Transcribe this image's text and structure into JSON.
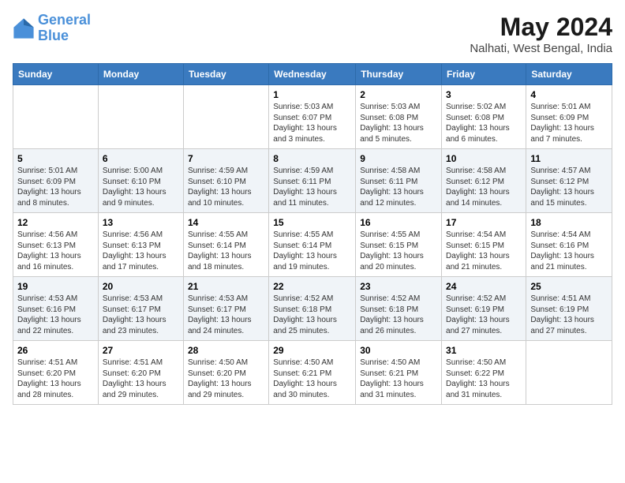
{
  "header": {
    "logo_line1": "General",
    "logo_line2": "Blue",
    "title": "May 2024",
    "subtitle": "Nalhati, West Bengal, India"
  },
  "calendar": {
    "days_of_week": [
      "Sunday",
      "Monday",
      "Tuesday",
      "Wednesday",
      "Thursday",
      "Friday",
      "Saturday"
    ],
    "weeks": [
      [
        {
          "day": "",
          "info": ""
        },
        {
          "day": "",
          "info": ""
        },
        {
          "day": "",
          "info": ""
        },
        {
          "day": "1",
          "info": "Sunrise: 5:03 AM\nSunset: 6:07 PM\nDaylight: 13 hours and 3 minutes."
        },
        {
          "day": "2",
          "info": "Sunrise: 5:03 AM\nSunset: 6:08 PM\nDaylight: 13 hours and 5 minutes."
        },
        {
          "day": "3",
          "info": "Sunrise: 5:02 AM\nSunset: 6:08 PM\nDaylight: 13 hours and 6 minutes."
        },
        {
          "day": "4",
          "info": "Sunrise: 5:01 AM\nSunset: 6:09 PM\nDaylight: 13 hours and 7 minutes."
        }
      ],
      [
        {
          "day": "5",
          "info": "Sunrise: 5:01 AM\nSunset: 6:09 PM\nDaylight: 13 hours and 8 minutes."
        },
        {
          "day": "6",
          "info": "Sunrise: 5:00 AM\nSunset: 6:10 PM\nDaylight: 13 hours and 9 minutes."
        },
        {
          "day": "7",
          "info": "Sunrise: 4:59 AM\nSunset: 6:10 PM\nDaylight: 13 hours and 10 minutes."
        },
        {
          "day": "8",
          "info": "Sunrise: 4:59 AM\nSunset: 6:11 PM\nDaylight: 13 hours and 11 minutes."
        },
        {
          "day": "9",
          "info": "Sunrise: 4:58 AM\nSunset: 6:11 PM\nDaylight: 13 hours and 12 minutes."
        },
        {
          "day": "10",
          "info": "Sunrise: 4:58 AM\nSunset: 6:12 PM\nDaylight: 13 hours and 14 minutes."
        },
        {
          "day": "11",
          "info": "Sunrise: 4:57 AM\nSunset: 6:12 PM\nDaylight: 13 hours and 15 minutes."
        }
      ],
      [
        {
          "day": "12",
          "info": "Sunrise: 4:56 AM\nSunset: 6:13 PM\nDaylight: 13 hours and 16 minutes."
        },
        {
          "day": "13",
          "info": "Sunrise: 4:56 AM\nSunset: 6:13 PM\nDaylight: 13 hours and 17 minutes."
        },
        {
          "day": "14",
          "info": "Sunrise: 4:55 AM\nSunset: 6:14 PM\nDaylight: 13 hours and 18 minutes."
        },
        {
          "day": "15",
          "info": "Sunrise: 4:55 AM\nSunset: 6:14 PM\nDaylight: 13 hours and 19 minutes."
        },
        {
          "day": "16",
          "info": "Sunrise: 4:55 AM\nSunset: 6:15 PM\nDaylight: 13 hours and 20 minutes."
        },
        {
          "day": "17",
          "info": "Sunrise: 4:54 AM\nSunset: 6:15 PM\nDaylight: 13 hours and 21 minutes."
        },
        {
          "day": "18",
          "info": "Sunrise: 4:54 AM\nSunset: 6:16 PM\nDaylight: 13 hours and 21 minutes."
        }
      ],
      [
        {
          "day": "19",
          "info": "Sunrise: 4:53 AM\nSunset: 6:16 PM\nDaylight: 13 hours and 22 minutes."
        },
        {
          "day": "20",
          "info": "Sunrise: 4:53 AM\nSunset: 6:17 PM\nDaylight: 13 hours and 23 minutes."
        },
        {
          "day": "21",
          "info": "Sunrise: 4:53 AM\nSunset: 6:17 PM\nDaylight: 13 hours and 24 minutes."
        },
        {
          "day": "22",
          "info": "Sunrise: 4:52 AM\nSunset: 6:18 PM\nDaylight: 13 hours and 25 minutes."
        },
        {
          "day": "23",
          "info": "Sunrise: 4:52 AM\nSunset: 6:18 PM\nDaylight: 13 hours and 26 minutes."
        },
        {
          "day": "24",
          "info": "Sunrise: 4:52 AM\nSunset: 6:19 PM\nDaylight: 13 hours and 27 minutes."
        },
        {
          "day": "25",
          "info": "Sunrise: 4:51 AM\nSunset: 6:19 PM\nDaylight: 13 hours and 27 minutes."
        }
      ],
      [
        {
          "day": "26",
          "info": "Sunrise: 4:51 AM\nSunset: 6:20 PM\nDaylight: 13 hours and 28 minutes."
        },
        {
          "day": "27",
          "info": "Sunrise: 4:51 AM\nSunset: 6:20 PM\nDaylight: 13 hours and 29 minutes."
        },
        {
          "day": "28",
          "info": "Sunrise: 4:50 AM\nSunset: 6:20 PM\nDaylight: 13 hours and 29 minutes."
        },
        {
          "day": "29",
          "info": "Sunrise: 4:50 AM\nSunset: 6:21 PM\nDaylight: 13 hours and 30 minutes."
        },
        {
          "day": "30",
          "info": "Sunrise: 4:50 AM\nSunset: 6:21 PM\nDaylight: 13 hours and 31 minutes."
        },
        {
          "day": "31",
          "info": "Sunrise: 4:50 AM\nSunset: 6:22 PM\nDaylight: 13 hours and 31 minutes."
        },
        {
          "day": "",
          "info": ""
        }
      ]
    ]
  }
}
